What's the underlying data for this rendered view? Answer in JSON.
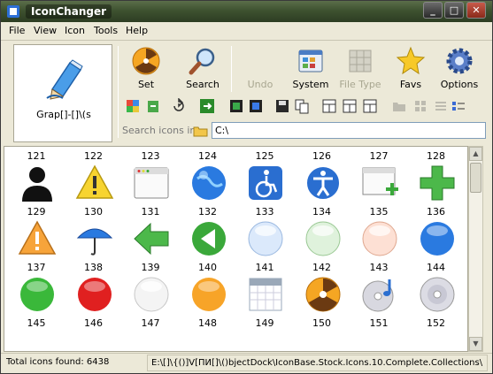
{
  "window": {
    "title": "IconChanger",
    "controls": [
      "minimize",
      "maximize",
      "close"
    ]
  },
  "menu": [
    "File",
    "View",
    "Icon",
    "Tools",
    "Help"
  ],
  "preview": {
    "label": "Grap[]-[]\\(s",
    "icon": "pencil-paint-icon"
  },
  "toolbar": {
    "set_label": "Set",
    "search_label": "Search",
    "undo_label": "Undo",
    "system_label": "System",
    "filetype_label": "File Type",
    "favs_label": "Favs",
    "options_label": "Options"
  },
  "search": {
    "label": "Search icons in",
    "path": "C:\\"
  },
  "grid": {
    "rows": [
      {
        "numbers": [
          "121",
          "122",
          "123",
          "124",
          "125",
          "126",
          "127",
          "128"
        ]
      },
      {
        "numbers": [
          "129",
          "130",
          "131",
          "132",
          "133",
          "134",
          "135",
          "136"
        ]
      },
      {
        "numbers": [
          "137",
          "138",
          "139",
          "140",
          "141",
          "142",
          "143",
          "144"
        ]
      },
      {
        "numbers": [
          "145",
          "146",
          "147",
          "148",
          "149",
          "150",
          "151",
          "152"
        ]
      }
    ],
    "icons": [
      [
        "user-silhouette-icon",
        "warning-triangle-icon",
        "app-window-icon",
        "globe-icon",
        "wheelchair-icon",
        "accessibility-icon",
        "new-window-icon",
        "plus-green-icon"
      ],
      [
        "warning-orange-icon",
        "umbrella-icon",
        "arrow-left-green-icon",
        "play-back-green-icon",
        "orb-light-blue-icon",
        "orb-light-green-icon",
        "orb-peach-icon",
        "orb-blue-icon"
      ],
      [
        "orb-green-icon",
        "orb-red-icon",
        "orb-white-icon",
        "orb-orange-icon",
        "calendar-icon",
        "radiation-icon",
        "music-cd-icon",
        "cd-disc-icon"
      ]
    ]
  },
  "status": {
    "total": "Total icons found: 6438",
    "path": "E:\\[]\\{()]V[ПИ[]\\()bjectDock\\IconBase.Stock.Icons.10.Complete.Collections\\"
  },
  "colors": {
    "accent": "#3e5230",
    "selection": "#316ac5"
  }
}
